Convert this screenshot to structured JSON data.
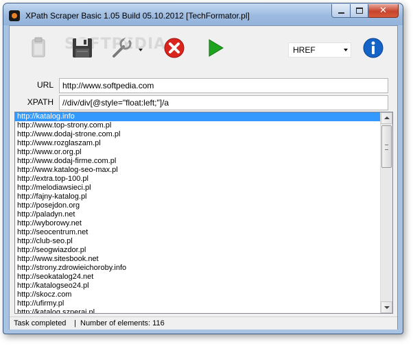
{
  "window": {
    "title": "XPath Scraper Basic 1.05 Build 05.10.2012 [TechFormator.pl]",
    "watermark": "SOFTPEDIA"
  },
  "toolbar": {
    "icons": [
      "clipboard-icon",
      "save-icon",
      "wrench-icon",
      "stop-icon",
      "play-icon",
      "info-icon"
    ],
    "combo_value": "HREF",
    "colors": {
      "stop": "#d9251d",
      "play": "#1ea31e",
      "info": "#1464c8"
    }
  },
  "form": {
    "url_label": "URL",
    "url_value": "http://www.softpedia.com",
    "xpath_label": "XPATH",
    "xpath_value": "//div/div[@style=\"float:left;\"]/a"
  },
  "results": [
    "http://katalog.info",
    "http://www.top-strony.com.pl",
    "http://www.dodaj-strone.com.pl",
    "http://www.rozglaszam.pl",
    "http://www.or.org.pl",
    "http://www.dodaj-firme.com.pl",
    "http://www.katalog-seo-max.pl",
    "http://extra.top-100.pl",
    "http://melodiawsieci.pl",
    "http://fajny-katalog.pl",
    "http://posejdon.org",
    "http://paladyn.net",
    "http://wyborowy.net",
    "http://seocentrum.net",
    "http://club-seo.pl",
    "http://seogwiazdor.pl",
    "http://www.sitesbook.net",
    "http://strony.zdrowieichoroby.info",
    "http://seokatalog24.net",
    "http://katalogseo24.pl",
    "http://skocz.com",
    "http://ufirmy.pl",
    "http://katalog.szperaj.pl"
  ],
  "status": {
    "task": "Task completed",
    "separator": "|",
    "count_text": "Number of elements: 116"
  }
}
